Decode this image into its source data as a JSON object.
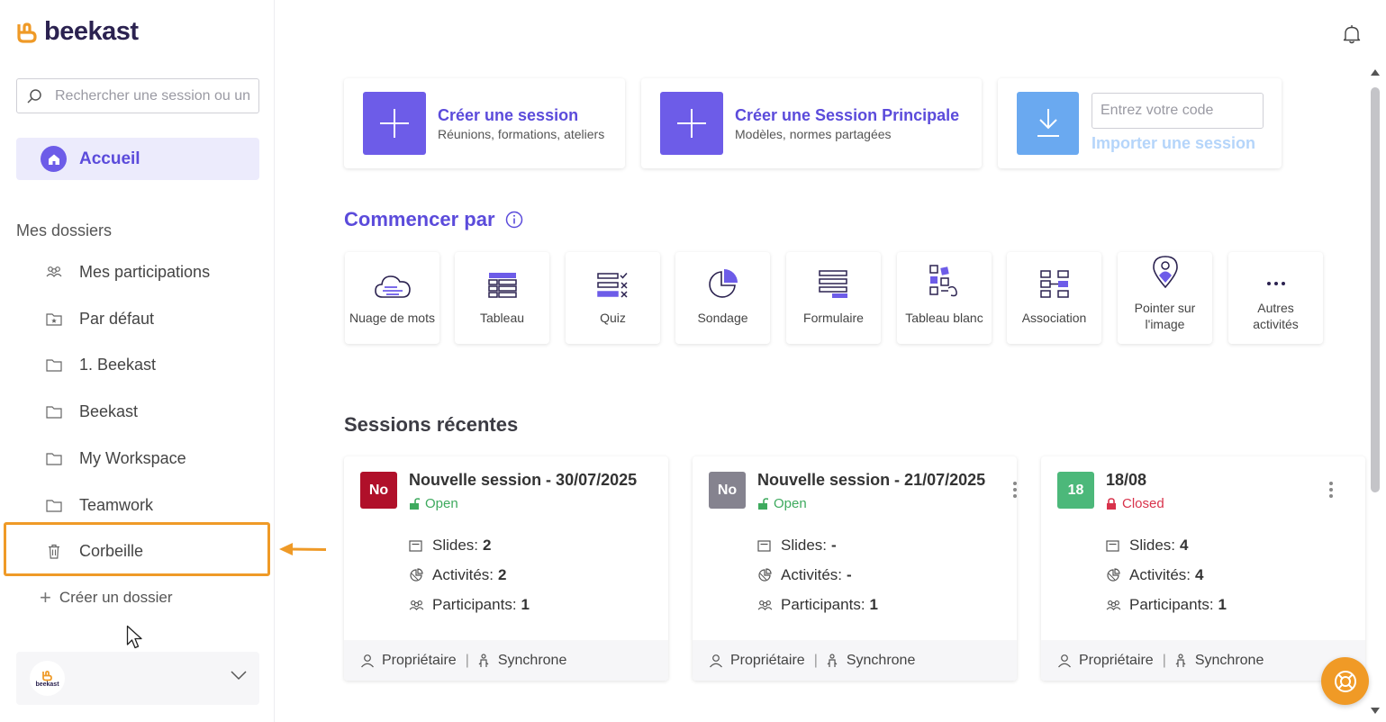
{
  "brand": {
    "name": "beekast",
    "avatar_text": "beekast",
    "logo_color": "#ef9a27"
  },
  "search": {
    "placeholder": "Rechercher une session ou un"
  },
  "nav": {
    "home_label": "Accueil"
  },
  "folders": {
    "title": "Mes dossiers",
    "items": [
      {
        "label": "Mes participations",
        "icon": "participants-icon"
      },
      {
        "label": "Par défaut",
        "icon": "folder-star-icon"
      },
      {
        "label": "1. Beekast",
        "icon": "folder-icon"
      },
      {
        "label": "Beekast",
        "icon": "folder-icon"
      },
      {
        "label": "My Workspace",
        "icon": "folder-icon"
      },
      {
        "label": "Teamwork",
        "icon": "folder-icon"
      },
      {
        "label": "Corbeille",
        "icon": "trash-icon"
      }
    ],
    "create_label": "Créer un dossier"
  },
  "top_cards": {
    "create_session": {
      "title": "Créer une session",
      "subtitle": "Réunions, formations, ateliers"
    },
    "create_main": {
      "title": "Créer une Session Principale",
      "subtitle": "Modèles, normes partagées"
    },
    "import": {
      "placeholder": "Entrez votre code",
      "link": "Importer une session"
    }
  },
  "start": {
    "title": "Commencer par",
    "activities": [
      {
        "label": "Nuage de mots",
        "icon": "word-cloud-icon"
      },
      {
        "label": "Tableau",
        "icon": "table-icon"
      },
      {
        "label": "Quiz",
        "icon": "quiz-icon"
      },
      {
        "label": "Sondage",
        "icon": "poll-icon"
      },
      {
        "label": "Formulaire",
        "icon": "form-icon"
      },
      {
        "label": "Tableau blanc",
        "icon": "whiteboard-icon"
      },
      {
        "label": "Association",
        "icon": "association-icon"
      },
      {
        "label": "Pointer sur l'image",
        "icon": "pin-image-icon"
      },
      {
        "label": "Autres activités",
        "icon": "more-icon"
      }
    ]
  },
  "recent": {
    "title": "Sessions récentes",
    "sessions": [
      {
        "badge": "No",
        "badge_color": "#b0102a",
        "title": "Nouvelle session - 30/07/2025",
        "status": "Open",
        "slides_label": "Slides:",
        "slides": "2",
        "activities_label": "Activités:",
        "activities": "2",
        "participants_label": "Participants:",
        "participants": "1",
        "role": "Propriétaire",
        "mode": "Synchrone"
      },
      {
        "badge": "No",
        "badge_color": "#85838f",
        "title": "Nouvelle session - 21/07/2025",
        "status": "Open",
        "slides_label": "Slides:",
        "slides": "-",
        "activities_label": "Activités:",
        "activities": "-",
        "participants_label": "Participants:",
        "participants": "1",
        "role": "Propriétaire",
        "mode": "Synchrone"
      },
      {
        "badge": "18",
        "badge_color": "#4cb87a",
        "title": "18/08",
        "status": "Closed",
        "slides_label": "Slides:",
        "slides": "4",
        "activities_label": "Activités:",
        "activities": "4",
        "participants_label": "Participants:",
        "participants": "1",
        "role": "Propriétaire",
        "mode": "Synchrone"
      }
    ]
  },
  "colors": {
    "accent": "#5b4bdb",
    "open": "#3eaa5e",
    "closed": "#d8324b",
    "highlight": "#ef9a27"
  }
}
